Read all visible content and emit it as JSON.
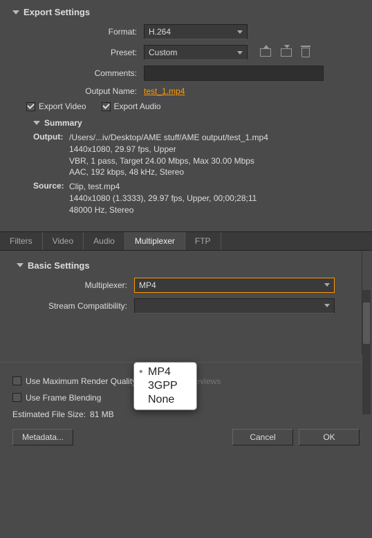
{
  "export": {
    "title": "Export Settings",
    "format_label": "Format:",
    "format_value": "H.264",
    "preset_label": "Preset:",
    "preset_value": "Custom",
    "comments_label": "Comments:",
    "comments_value": "",
    "output_name_label": "Output Name:",
    "output_name_link": "test_1.mp4",
    "export_video_label": "Export Video",
    "export_video_checked": true,
    "export_audio_label": "Export Audio",
    "export_audio_checked": true
  },
  "summary": {
    "title": "Summary",
    "output_label": "Output:",
    "output_lines": [
      "/Users/...iv/Desktop/AME stuff/AME output/test_1.mp4",
      "1440x1080, 29.97 fps, Upper",
      "VBR, 1 pass, Target 24.00 Mbps, Max 30.00 Mbps",
      "AAC, 192 kbps, 48 kHz, Stereo"
    ],
    "source_label": "Source:",
    "source_lines": [
      "Clip, test.mp4",
      "1440x1080 (1.3333), 29.97 fps, Upper, 00;00;28;11",
      "48000 Hz, Stereo"
    ]
  },
  "tabs": {
    "items": [
      {
        "label": "Filters",
        "active": false
      },
      {
        "label": "Video",
        "active": false
      },
      {
        "label": "Audio",
        "active": false
      },
      {
        "label": "Multiplexer",
        "active": true
      },
      {
        "label": "FTP",
        "active": false
      }
    ]
  },
  "basic": {
    "title": "Basic Settings",
    "mux_label": "Multiplexer:",
    "mux_value": "MP4",
    "stream_label": "Stream Compatibility:",
    "stream_value": "",
    "popup_items": [
      {
        "label": "MP4",
        "selected": true
      },
      {
        "label": "3GPP",
        "selected": false
      },
      {
        "label": "None",
        "selected": false
      }
    ]
  },
  "bottom": {
    "max_quality": "Use Maximum Render Quality",
    "use_previews": "Use Previews",
    "frame_blending": "Use Frame Blending",
    "est_label": "Estimated File Size:",
    "est_value": "81 MB",
    "metadata_btn": "Metadata...",
    "cancel_btn": "Cancel",
    "ok_btn": "OK"
  },
  "icons": {
    "save": "save-preset-icon",
    "import": "import-preset-icon",
    "delete": "delete-preset-icon"
  }
}
